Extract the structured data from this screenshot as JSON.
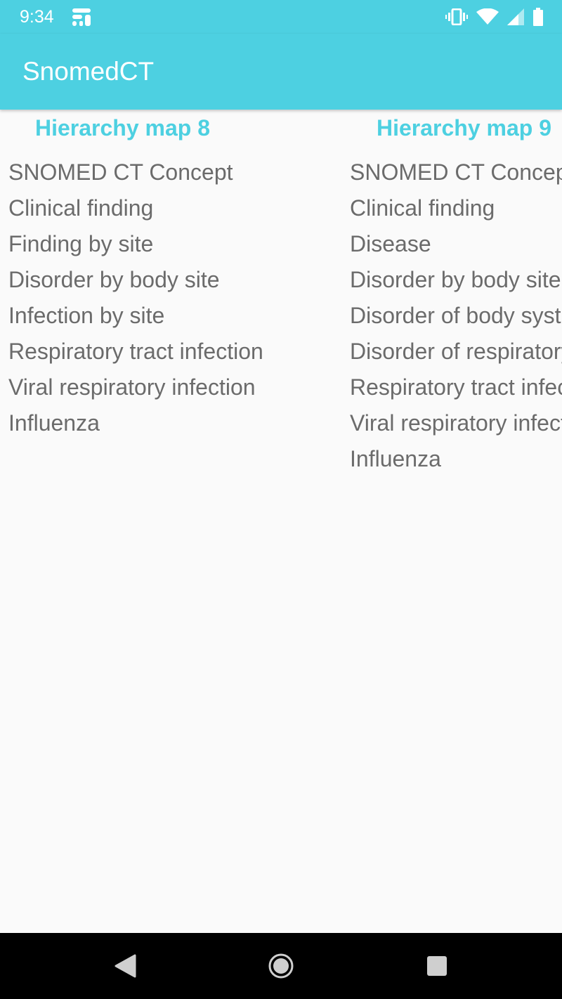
{
  "status_bar": {
    "time": "9:34",
    "icons": [
      "fi-network-icon",
      "vibrate-icon",
      "wifi-icon",
      "cell-signal-icon",
      "battery-icon"
    ]
  },
  "app_bar": {
    "title": "SnomedCT"
  },
  "columns": [
    {
      "title": "Hierarchy map 8",
      "items": [
        "SNOMED CT Concept",
        "Clinical finding",
        "Finding by site",
        "Disorder by body site",
        "Infection by site",
        "Respiratory tract infection",
        "Viral respiratory infection",
        "Influenza"
      ]
    },
    {
      "title": "Hierarchy map 9",
      "items": [
        "SNOMED CT Concept",
        "Clinical finding",
        "Disease",
        "Disorder by body site",
        "Disorder of body system",
        "Disorder of respiratory system",
        "Respiratory tract infection",
        "Viral respiratory infection",
        "Influenza"
      ]
    }
  ],
  "nav_bar": {
    "icons": [
      "back-icon",
      "home-icon",
      "recents-icon"
    ]
  },
  "colors": {
    "accent": "#4dd0e1",
    "text": "#6b6b6b",
    "background": "#fafafa",
    "nav": "#000000"
  }
}
